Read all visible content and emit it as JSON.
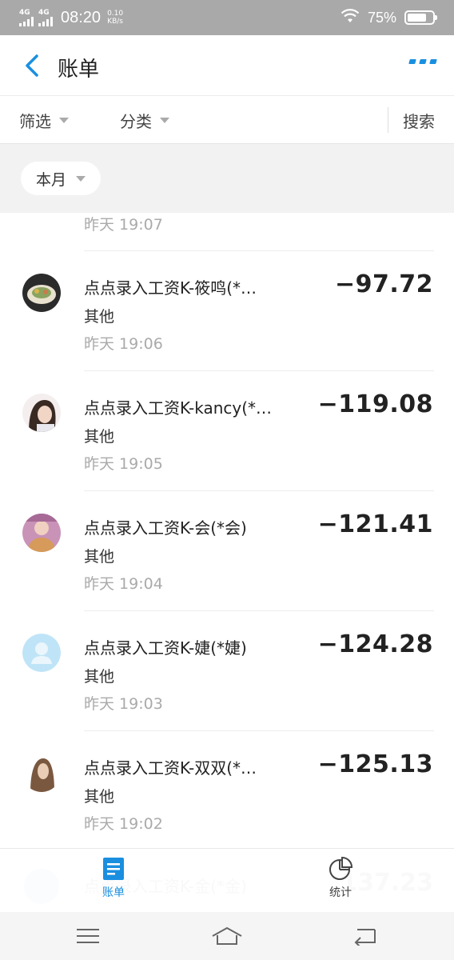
{
  "status_bar": {
    "network_1": "4G",
    "network_2": "4G",
    "time": "08:20",
    "speed_value": "0.10",
    "speed_unit": "KB/s",
    "battery_percent": "75%",
    "battery_level": 0.75
  },
  "header": {
    "title": "账单",
    "back_icon": "chevron-left-icon",
    "more_icon": "more-icon",
    "accent_color": "#1a8fe0"
  },
  "filters": {
    "filter_label": "筛选",
    "category_label": "分类",
    "search_label": "搜索"
  },
  "period": {
    "selected": "本月"
  },
  "transactions": {
    "partial_time": "昨天  19:07",
    "items": [
      {
        "name": "点点录入工资K-筱鸣(*…",
        "category": "其他",
        "time": "昨天  19:06",
        "amount": "−97.72"
      },
      {
        "name": "点点录入工资K-kancy(*…",
        "category": "其他",
        "time": "昨天  19:05",
        "amount": "−119.08"
      },
      {
        "name": "点点录入工资K-会(*会)",
        "category": "其他",
        "time": "昨天  19:04",
        "amount": "−121.41"
      },
      {
        "name": "点点录入工资K-婕(*婕)",
        "category": "其他",
        "time": "昨天  19:03",
        "amount": "−124.28"
      },
      {
        "name": "点点录入工资K-双双(*…",
        "category": "其他",
        "time": "昨天  19:02",
        "amount": "−125.13"
      }
    ],
    "ghost": {
      "name": "点点录入工资K-金(*金)",
      "amount": "137.23"
    }
  },
  "tabbar": {
    "bill_label": "账单",
    "stats_label": "统计"
  },
  "navbar": {
    "menu_icon": "menu-icon",
    "home_icon": "home-icon",
    "back_icon": "back-icon"
  }
}
